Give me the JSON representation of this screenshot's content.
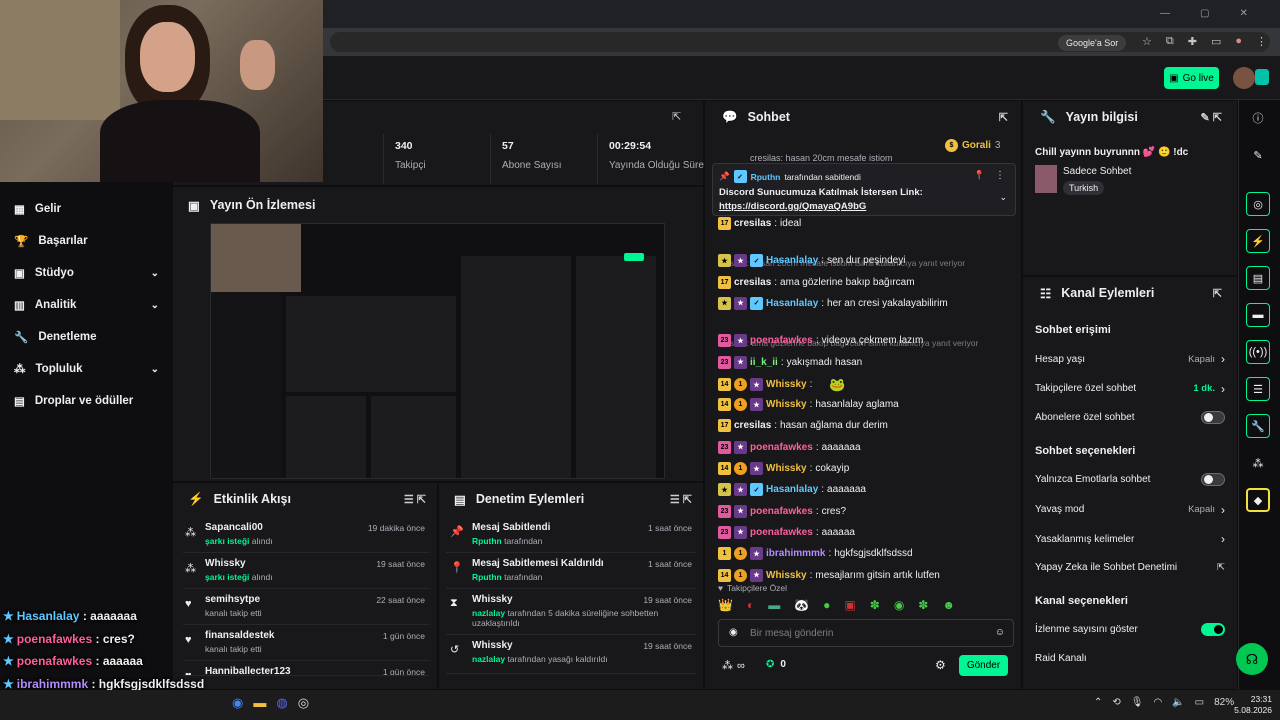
{
  "browser": {
    "search_chip": "Google'a Sor"
  },
  "header": {
    "go_live": "Go live"
  },
  "sidebar": {
    "items": [
      {
        "label": "Gelir",
        "icon": "money-icon"
      },
      {
        "label": "Başarılar",
        "icon": "trophy-icon"
      },
      {
        "label": "Stüdyo",
        "icon": "studio-icon"
      },
      {
        "label": "Analitik",
        "icon": "analytics-icon"
      },
      {
        "label": "Denetleme",
        "icon": "moderation-icon"
      },
      {
        "label": "Topluluk",
        "icon": "community-icon"
      },
      {
        "label": "Droplar ve ödüller",
        "icon": "drops-icon"
      }
    ]
  },
  "stats": [
    {
      "value": "340",
      "label": "Takipçi"
    },
    {
      "value": "57",
      "label": "Abone Sayısı"
    },
    {
      "value": "00:29:54",
      "label": "Yayında Olduğu Süre"
    }
  ],
  "preview": {
    "title": "Yayın Ön İzlemesi"
  },
  "activity": {
    "title": "Etkinlik Akışı",
    "items": [
      {
        "name": "Sapancali00",
        "sub_b": "şarkı isteği",
        "sub": " alındı",
        "time": "19 dakika önce"
      },
      {
        "name": "Whissky",
        "sub_b": "şarkı isteği",
        "sub": " alındı",
        "time": "19 saat önce"
      },
      {
        "name": "semihsytpe",
        "sub_b": "",
        "sub": "kanalı takip etti",
        "time": "22 saat önce"
      },
      {
        "name": "finansaldestek",
        "sub_b": "",
        "sub": "kanalı takip etti",
        "time": "1 gün önce"
      },
      {
        "name": "Hanniballecter123",
        "sub_b": "",
        "sub": "",
        "time": "1 gün önce"
      }
    ]
  },
  "modlog": {
    "title": "Denetim Eylemleri",
    "items": [
      {
        "name": "Mesaj Sabitlendi",
        "sub_b": "Rputhn",
        "sub": " tarafından",
        "time": "1 saat önce"
      },
      {
        "name": "Mesaj Sabitlemesi Kaldırıldı",
        "sub_b": "Rputhn",
        "sub": " tarafından",
        "time": "1 saat önce"
      },
      {
        "name": "Whissky",
        "sub_b": "nazlalay",
        "sub": " tarafından 5 dakika süreliğine sohbetten uzaklaştırıldı",
        "time": "19 saat önce"
      },
      {
        "name": "Whissky",
        "sub_b": "nazlalay",
        "sub": " tarafından yasağı kaldırıldı",
        "time": "19 saat önce"
      }
    ]
  },
  "chat": {
    "title": "Sohbet",
    "goral_label": "Gorali",
    "goral_count": "3",
    "top_line": "cresilas: hasan 20cm mesafe istiom",
    "pinned": {
      "by": "Rputhn",
      "by_suffix": "tarafından sabitlendi",
      "text": "Discord Sunucumuza Katılmak İstersen Link:",
      "link": "https://discord.gg/QmayaQA9bG"
    },
    "messages": [
      {
        "kind": "msg",
        "user": "cresilas",
        "color": "#efeff1",
        "text": "ideal",
        "b1": "17",
        "b1c": "#f0c040"
      },
      {
        "kind": "reply",
        "text": "cresilas: hasan 20cm mesafe istiom isimli kullanıcıya yanıt veriyor"
      },
      {
        "kind": "msg",
        "user": "Hasanlalay",
        "color": "#5ec8ff",
        "text": "sen dur peşindeyi",
        "b1": "★",
        "b1c": "#d6c34a"
      },
      {
        "kind": "msg",
        "user": "cresilas",
        "color": "#efeff1",
        "text": "ama gözlerine bakıp bağırcam",
        "b1": "17",
        "b1c": "#f0c040"
      },
      {
        "kind": "msg",
        "user": "Hasanlalay",
        "color": "#5ec8ff",
        "text": "her an cresi yakalayabilirim",
        "b1": "★",
        "b1c": "#d6c34a"
      },
      {
        "kind": "reply",
        "text": "cresilas: ama gözlerine bakıp bağırcam isimli kullanıcıya yanıt veriyor"
      },
      {
        "kind": "msg",
        "user": "poenafawkes",
        "color": "#ff5fa0",
        "text": "videoya çekmem lazım",
        "b1": "23",
        "b1c": "#e05aa0"
      },
      {
        "kind": "msg",
        "user": "ii_k_ii",
        "color": "#7cf07c",
        "text": "yakışmadı hasan",
        "b1": "23",
        "b1c": "#e05aa0"
      },
      {
        "kind": "msg",
        "user": "Whissky",
        "color": "#f0c040",
        "text": "",
        "b1": "14",
        "b1c": "#f0c040",
        "emote": true
      },
      {
        "kind": "msg",
        "user": "Whissky",
        "color": "#f0c040",
        "text": "hasanlalay aglama",
        "b1": "14",
        "b1c": "#f0c040"
      },
      {
        "kind": "msg",
        "user": "cresilas",
        "color": "#efeff1",
        "text": "hasan ağlama dur derim",
        "b1": "17",
        "b1c": "#f0c040"
      },
      {
        "kind": "msg",
        "user": "poenafawkes",
        "color": "#ff5fa0",
        "text": "aaaaaaa",
        "b1": "23",
        "b1c": "#e05aa0"
      },
      {
        "kind": "msg",
        "user": "Whissky",
        "color": "#f0c040",
        "text": "cokayip",
        "b1": "14",
        "b1c": "#f0c040"
      },
      {
        "kind": "msg",
        "user": "Hasanlalay",
        "color": "#5ec8ff",
        "text": "aaaaaaa",
        "b1": "★",
        "b1c": "#d6c34a"
      },
      {
        "kind": "msg",
        "user": "poenafawkes",
        "color": "#ff5fa0",
        "text": "cres?",
        "b1": "23",
        "b1c": "#e05aa0"
      },
      {
        "kind": "msg",
        "user": "poenafawkes",
        "color": "#ff5fa0",
        "text": "aaaaaa",
        "b1": "23",
        "b1c": "#e05aa0"
      },
      {
        "kind": "msg",
        "user": "ibrahimmmk",
        "color": "#b28cff",
        "text": "hgkfsgjsdklfsdssd",
        "b1": "1",
        "b1c": "#f0c040"
      },
      {
        "kind": "msg",
        "user": "Whissky",
        "color": "#f0c040",
        "text": "mesajlarım gitsin artık lutfen",
        "b1": "14",
        "b1c": "#f0c040"
      }
    ],
    "followers_only": "Takipçilere Özel",
    "input_placeholder": "Bir mesaj gönderin",
    "points": "0",
    "send": "Gönder",
    "infinity": "∞"
  },
  "info": {
    "title": "Yayın bilgisi",
    "stream_title": "Chill yayınn buyrunnn 💕 🙂 !dc",
    "category": "Sadece Sohbet",
    "tag": "Turkish"
  },
  "channel_actions": {
    "title": "Kanal Eylemleri",
    "chat_access": "Sohbet erişimi",
    "rows1": [
      {
        "label": "Hesap yaşı",
        "value": "Kapalı",
        "type": "chev"
      },
      {
        "label": "Takipçilere özel sohbet",
        "value": "1 dk.",
        "type": "chev",
        "green": true
      },
      {
        "label": "Abonelere özel sohbet",
        "value": "",
        "type": "toggle"
      }
    ],
    "chat_options": "Sohbet seçenekleri",
    "rows2": [
      {
        "label": "Yalnızca Emotlarla sohbet",
        "value": "",
        "type": "toggle"
      },
      {
        "label": "Yavaş mod",
        "value": "Kapalı",
        "type": "chev"
      },
      {
        "label": "Yasaklanmış kelimeler",
        "value": "",
        "type": "chev"
      },
      {
        "label": "Yapay Zeka ile Sohbet Denetimi",
        "value": "",
        "type": "ext"
      }
    ],
    "channel_options": "Kanal seçenekleri",
    "rows3": [
      {
        "label": "İzlenme sayısını göster",
        "value": "",
        "type": "toggle-on"
      },
      {
        "label": "Raid Kanalı",
        "value": "",
        "type": "none"
      }
    ]
  },
  "overlay_chat": [
    {
      "user": "Hasanlalay",
      "color": "#5ec8ff",
      "text": "aaaaaaa"
    },
    {
      "user": "poenafawkes",
      "color": "#ff5fa0",
      "text": "cres?"
    },
    {
      "user": "poenafawkes",
      "color": "#ff5fa0",
      "text": "aaaaaa"
    },
    {
      "user": "ibrahimmmk",
      "color": "#b28cff",
      "text": "hgkfsgjsdklfsdssd"
    },
    {
      "user": "Whissky",
      "color": "#f0c040",
      "text": "mesajlarım gitsin artık lutfen"
    }
  ],
  "taskbar": {
    "battery": "82%",
    "time": "23:31",
    "date": "5.08.2026"
  }
}
